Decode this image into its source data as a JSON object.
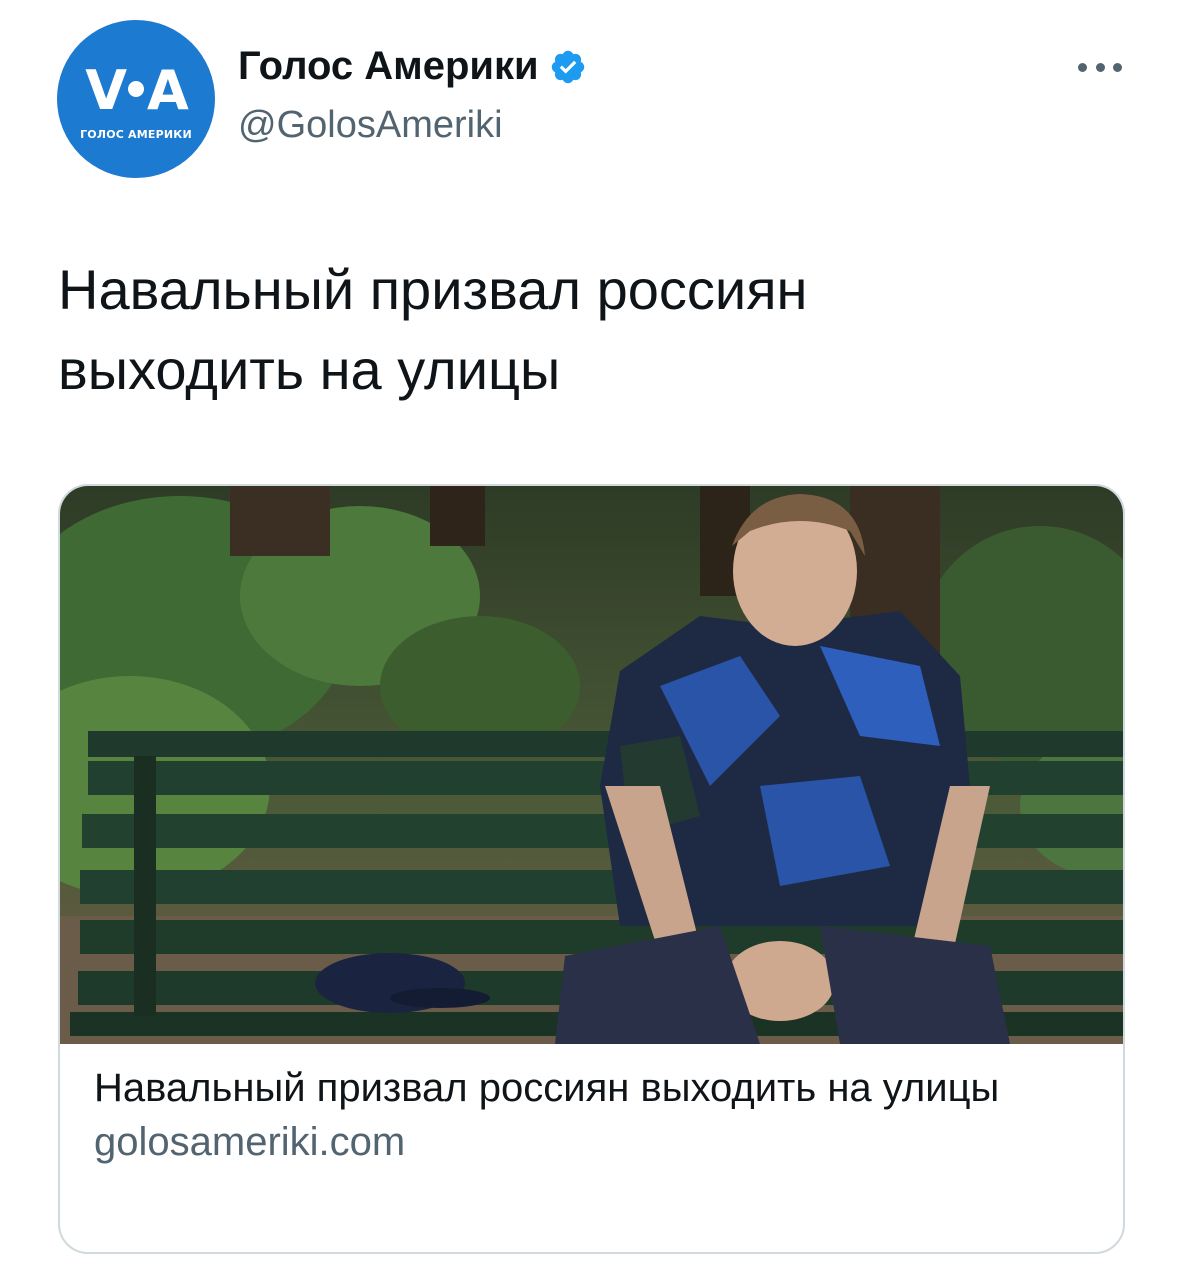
{
  "author": {
    "display_name": "Голос Америки",
    "handle": "@GolosAmeriki",
    "verified": true,
    "avatar": {
      "logo_left": "V",
      "logo_right": "A",
      "logo_subtitle": "ГОЛОС АМЕРИКИ",
      "bg_color": "#1d7ad1"
    }
  },
  "more_menu_icon": "more-horizontal-icon",
  "tweet": {
    "text": "Навальный призвал россиян выходить на улицы"
  },
  "link_card": {
    "title": "Навальный призвал россиян выходить на улицы",
    "domain": "golosameriki.com"
  },
  "colors": {
    "verified_badge": "#1d9bf0",
    "secondary_text": "#536471",
    "card_border": "#cfd9de"
  }
}
